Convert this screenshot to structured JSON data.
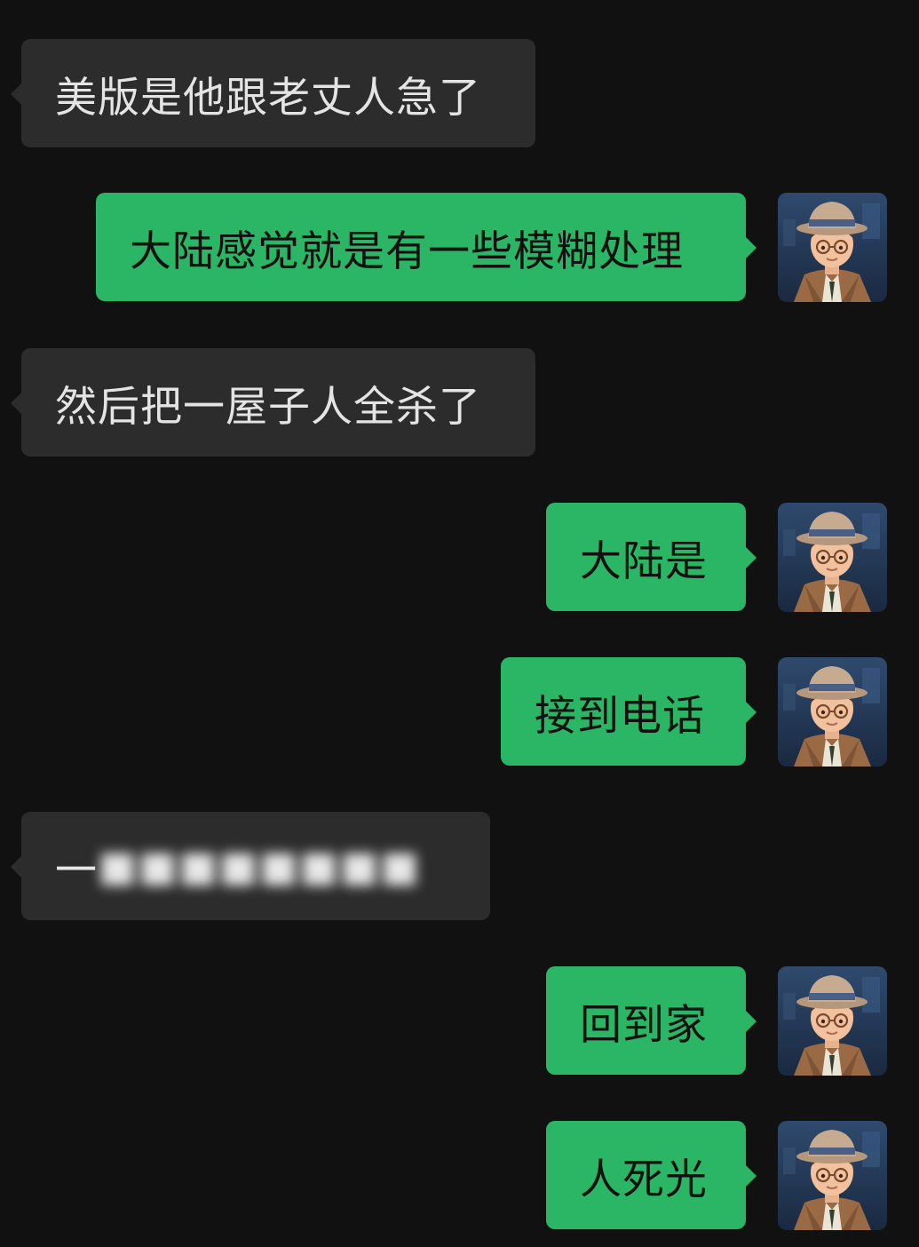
{
  "chat": {
    "messages": [
      {
        "direction": "incoming",
        "text": "美版是他跟老丈人急了"
      },
      {
        "direction": "outgoing",
        "text": "大陆感觉就是有一些模糊处理",
        "avatar_icon": "cartoon-man-hat-glasses-avatar-icon"
      },
      {
        "direction": "incoming",
        "text": "然后把一屋子人全杀了"
      },
      {
        "direction": "outgoing",
        "text": "大陆是",
        "avatar_icon": "cartoon-man-hat-glasses-avatar-icon"
      },
      {
        "direction": "outgoing",
        "text": "接到电话",
        "avatar_icon": "cartoon-man-hat-glasses-avatar-icon"
      },
      {
        "direction": "incoming",
        "text": "一",
        "blurred": true
      },
      {
        "direction": "outgoing",
        "text": "回到家",
        "avatar_icon": "cartoon-man-hat-glasses-avatar-icon"
      },
      {
        "direction": "outgoing",
        "text": "人死光",
        "avatar_icon": "cartoon-man-hat-glasses-avatar-icon"
      }
    ]
  },
  "colors": {
    "background": "#111111",
    "incoming_bubble": "#2c2c2c",
    "incoming_text": "#e4e4e4",
    "outgoing_bubble": "#2bb666",
    "outgoing_text": "#111111"
  }
}
